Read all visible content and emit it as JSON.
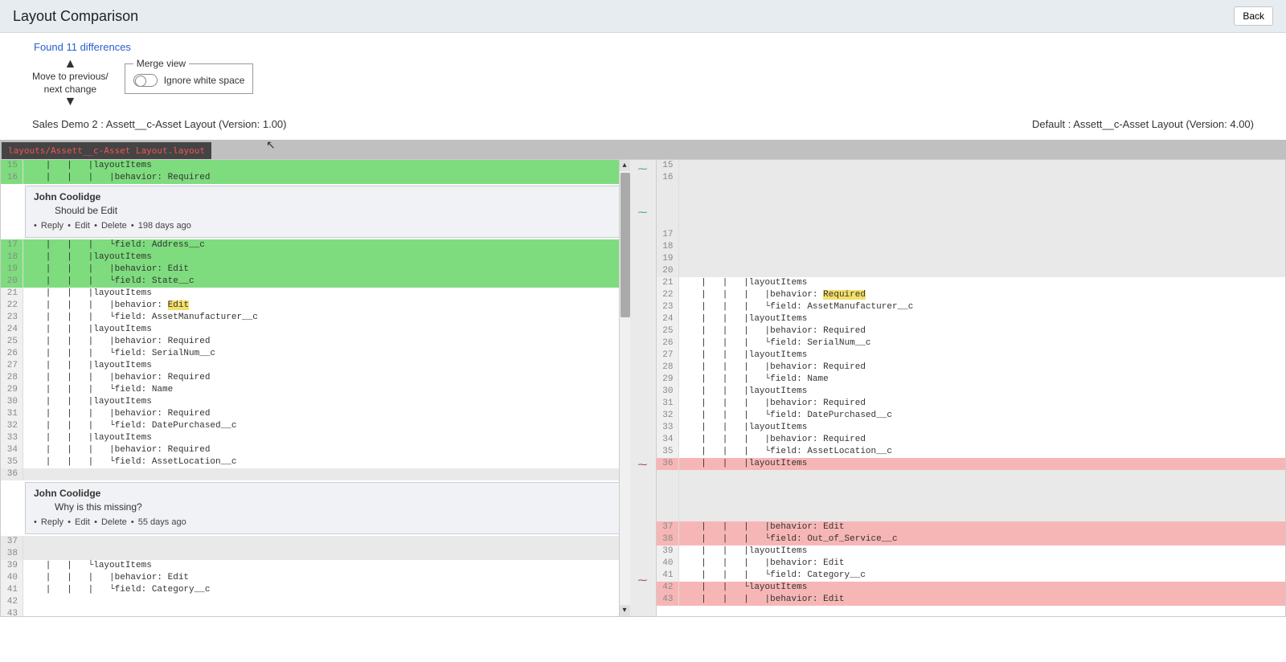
{
  "header": {
    "title": "Layout Comparison",
    "back": "Back"
  },
  "found": "Found 11 differences",
  "nav": {
    "text_top": "Move to previous/",
    "text_bottom": "next change"
  },
  "merge": {
    "legend": "Merge view",
    "ignore_ws": "Ignore white space"
  },
  "versions": {
    "left": "Sales Demo 2 : Assett__c-Asset Layout (Version: 1.00)",
    "right": "Default : Assett__c-Asset Layout (Version: 4.00)"
  },
  "tab": "layouts/Assett__c-Asset Layout.layout",
  "comment1": {
    "author": "John Coolidge",
    "body": "Should be Edit",
    "reply": "Reply",
    "edit": "Edit",
    "delete": "Delete",
    "time": "198 days ago"
  },
  "comment2": {
    "author": "John Coolidge",
    "body": "Why is this missing?",
    "reply": "Reply",
    "edit": "Edit",
    "delete": "Delete",
    "time": "55 days ago"
  },
  "left_lines": [
    {
      "n": "15",
      "cls": "green",
      "t": "   |   |   |layoutItems"
    },
    {
      "n": "16",
      "cls": "green",
      "t": "   |   |   |   |behavior: Required"
    },
    {
      "comment": 1
    },
    {
      "n": "17",
      "cls": "green",
      "t": "   |   |   |   └field: Address__c"
    },
    {
      "n": "18",
      "cls": "green",
      "t": "   |   |   |layoutItems"
    },
    {
      "n": "19",
      "cls": "green",
      "t": "   |   |   |   |behavior: Edit"
    },
    {
      "n": "20",
      "cls": "green",
      "t": "   |   |   |   └field: State__c"
    },
    {
      "n": "21",
      "cls": "",
      "t": "   |   |   |layoutItems"
    },
    {
      "n": "22",
      "cls": "",
      "t_pre": "   |   |   |   |behavior: ",
      "hl": "Edit"
    },
    {
      "n": "23",
      "cls": "",
      "t": "   |   |   |   └field: AssetManufacturer__c"
    },
    {
      "n": "24",
      "cls": "",
      "t": "   |   |   |layoutItems"
    },
    {
      "n": "25",
      "cls": "",
      "t": "   |   |   |   |behavior: Required"
    },
    {
      "n": "26",
      "cls": "",
      "t": "   |   |   |   └field: SerialNum__c"
    },
    {
      "n": "27",
      "cls": "",
      "t": "   |   |   |layoutItems"
    },
    {
      "n": "28",
      "cls": "",
      "t": "   |   |   |   |behavior: Required"
    },
    {
      "n": "29",
      "cls": "",
      "t": "   |   |   |   └field: Name"
    },
    {
      "n": "30",
      "cls": "",
      "t": "   |   |   |layoutItems"
    },
    {
      "n": "31",
      "cls": "",
      "t": "   |   |   |   |behavior: Required"
    },
    {
      "n": "32",
      "cls": "",
      "t": "   |   |   |   └field: DatePurchased__c"
    },
    {
      "n": "33",
      "cls": "",
      "t": "   |   |   |layoutItems"
    },
    {
      "n": "34",
      "cls": "",
      "t": "   |   |   |   |behavior: Required"
    },
    {
      "n": "35",
      "cls": "",
      "t": "   |   |   |   └field: AssetLocation__c"
    },
    {
      "n": "36",
      "cls": "graybg",
      "t": ""
    },
    {
      "comment": 2
    },
    {
      "n": "37",
      "cls": "graybg",
      "t": ""
    },
    {
      "n": "38",
      "cls": "graybg",
      "t": ""
    },
    {
      "n": "39",
      "cls": "",
      "t": "   |   |   └layoutItems"
    },
    {
      "n": "40",
      "cls": "",
      "t": "   |   |   |   |behavior: Edit"
    },
    {
      "n": "41",
      "cls": "",
      "t": "   |   |   |   └field: Category__c"
    },
    {
      "n": "42",
      "cls": "",
      "t": ""
    },
    {
      "n": "43",
      "cls": "",
      "t": ""
    }
  ],
  "right_lines": [
    {
      "n": "15",
      "cls": "graybg",
      "t": ""
    },
    {
      "n": "16",
      "cls": "graybg",
      "t": ""
    },
    {
      "blank_gray": true,
      "h": 56
    },
    {
      "n": "17",
      "cls": "graybg",
      "t": ""
    },
    {
      "n": "18",
      "cls": "graybg",
      "t": ""
    },
    {
      "n": "19",
      "cls": "graybg",
      "t": ""
    },
    {
      "n": "20",
      "cls": "graybg",
      "t": ""
    },
    {
      "n": "21",
      "cls": "",
      "t": "   |   |   |layoutItems"
    },
    {
      "n": "22",
      "cls": "",
      "t_pre": "   |   |   |   |behavior: ",
      "hl": "Required"
    },
    {
      "n": "23",
      "cls": "",
      "t": "   |   |   |   └field: AssetManufacturer__c"
    },
    {
      "n": "24",
      "cls": "",
      "t": "   |   |   |layoutItems"
    },
    {
      "n": "25",
      "cls": "",
      "t": "   |   |   |   |behavior: Required"
    },
    {
      "n": "26",
      "cls": "",
      "t": "   |   |   |   └field: SerialNum__c"
    },
    {
      "n": "27",
      "cls": "",
      "t": "   |   |   |layoutItems"
    },
    {
      "n": "28",
      "cls": "",
      "t": "   |   |   |   |behavior: Required"
    },
    {
      "n": "29",
      "cls": "",
      "t": "   |   |   |   └field: Name"
    },
    {
      "n": "30",
      "cls": "",
      "t": "   |   |   |layoutItems"
    },
    {
      "n": "31",
      "cls": "",
      "t": "   |   |   |   |behavior: Required"
    },
    {
      "n": "32",
      "cls": "",
      "t": "   |   |   |   └field: DatePurchased__c"
    },
    {
      "n": "33",
      "cls": "",
      "t": "   |   |   |layoutItems"
    },
    {
      "n": "34",
      "cls": "",
      "t": "   |   |   |   |behavior: Required"
    },
    {
      "n": "35",
      "cls": "",
      "t": "   |   |   |   └field: AssetLocation__c"
    },
    {
      "n": "36",
      "cls": "pink",
      "t": "   |   |   |layoutItems"
    },
    {
      "blank_gray": true,
      "h": 64
    },
    {
      "n": "37",
      "cls": "pink",
      "t": "   |   |   |   |behavior: Edit"
    },
    {
      "n": "38",
      "cls": "pink",
      "t": "   |   |   |   └field: Out_of_Service__c"
    },
    {
      "n": "39",
      "cls": "",
      "t": "   |   |   |layoutItems"
    },
    {
      "n": "40",
      "cls": "",
      "t": "   |   |   |   |behavior: Edit"
    },
    {
      "n": "41",
      "cls": "",
      "t": "   |   |   |   └field: Category__c"
    },
    {
      "n": "42",
      "cls": "pink",
      "t": "   |   |   └layoutItems"
    },
    {
      "n": "43",
      "cls": "pink",
      "t": "   |   |   |   |behavior: Edit"
    }
  ]
}
